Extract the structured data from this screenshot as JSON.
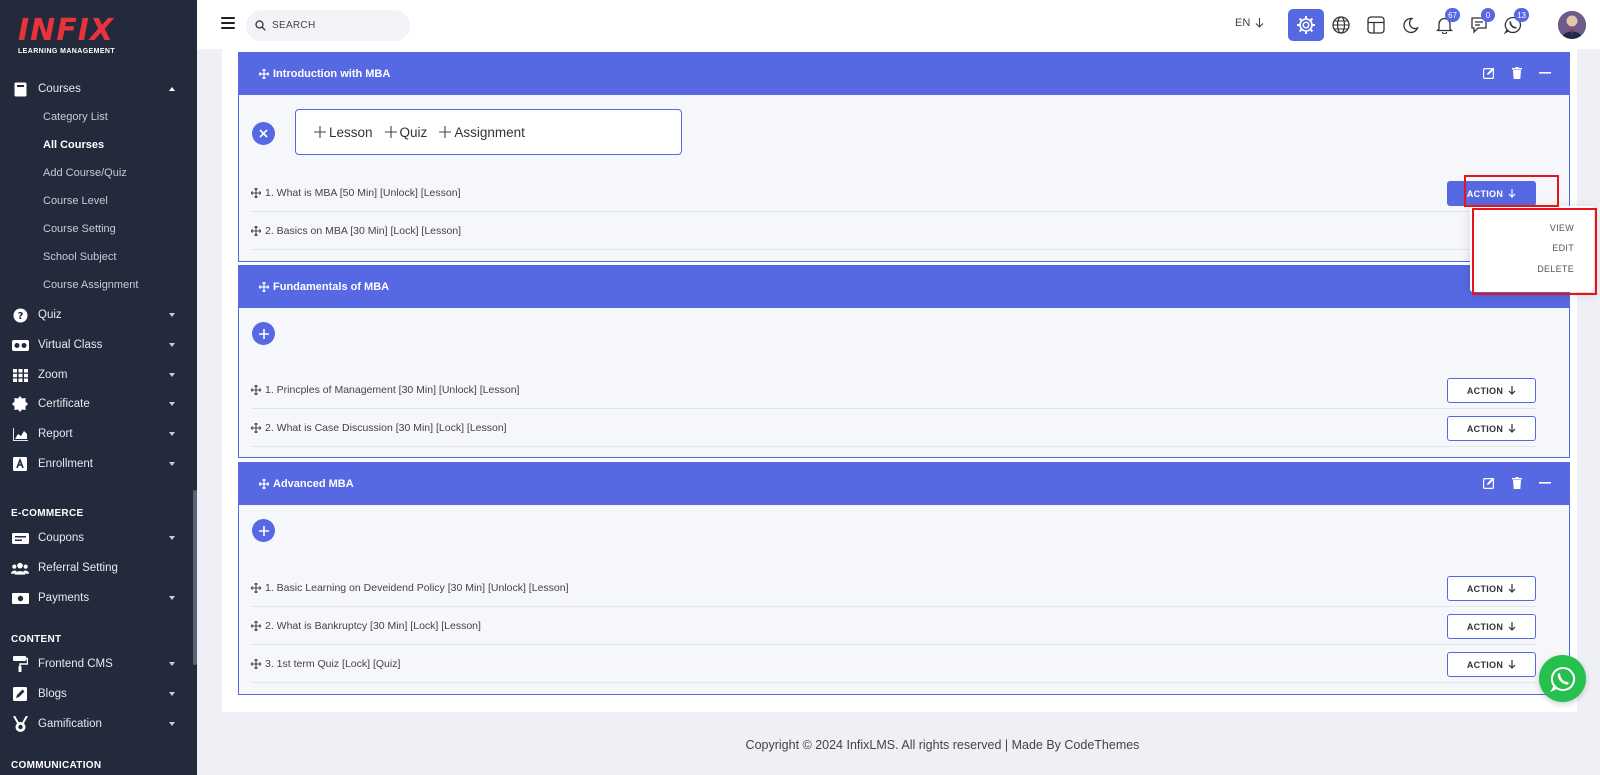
{
  "brand": {
    "logo_text": "INFIX",
    "logo_subtitle": "LEARNING MANAGEMENT"
  },
  "sidebar": {
    "courses": {
      "label": "Courses",
      "children": [
        "Category List",
        "All Courses",
        "Add Course/Quiz",
        "Course Level",
        "Course Setting",
        "School Subject",
        "Course Assignment"
      ],
      "active_child": "All Courses"
    },
    "items": [
      {
        "label": "Quiz",
        "icon": "question-icon"
      },
      {
        "label": "Virtual Class",
        "icon": "vr-icon"
      },
      {
        "label": "Zoom",
        "icon": "grid-icon"
      },
      {
        "label": "Certificate",
        "icon": "certificate-icon"
      },
      {
        "label": "Report",
        "icon": "chart-icon"
      },
      {
        "label": "Enrollment",
        "icon": "enrollment-icon"
      }
    ],
    "ecommerce_title": "E-COMMERCE",
    "ecommerce": [
      {
        "label": "Coupons",
        "icon": "coupon-icon"
      },
      {
        "label": "Referral Setting",
        "icon": "users-icon"
      },
      {
        "label": "Payments",
        "icon": "money-icon"
      }
    ],
    "content_title": "CONTENT",
    "content": [
      {
        "label": "Frontend CMS",
        "icon": "paint-roller-icon"
      },
      {
        "label": "Blogs",
        "icon": "blog-icon"
      },
      {
        "label": "Gamification",
        "icon": "medal-icon"
      }
    ],
    "communication_title": "COMMUNICATION"
  },
  "header": {
    "search_placeholder": "SEARCH",
    "language": "EN",
    "badges": {
      "notifications": "67",
      "messages": "0",
      "whatsapp": "13"
    }
  },
  "sections": [
    {
      "title": "Introduction with MBA",
      "add_options": [
        "Lesson",
        "Quiz",
        "Assignment"
      ],
      "lessons": [
        "1. What is MBA [50 Min] [Unlock] [Lesson]",
        "2. Basics on MBA [30 Min] [Lock] [Lesson]"
      ]
    },
    {
      "title": "Fundamentals of MBA",
      "lessons": [
        "1. Princples of Management [30 Min] [Unlock] [Lesson]",
        "2. What is Case Discussion [30 Min] [Lock] [Lesson]"
      ]
    },
    {
      "title": "Advanced MBA",
      "lessons": [
        "1. Basic Learning on Deveidend Policy [30 Min] [Unlock] [Lesson]",
        "2. What is Bankruptcy [30 Min] [Lock] [Lesson]",
        "3. 1st term Quiz [Lock] [Quiz]"
      ]
    }
  ],
  "action_label": "ACTION",
  "action_menu": [
    "VIEW",
    "EDIT",
    "DELETE"
  ],
  "footer": "Copyright © 2024 InfixLMS. All rights reserved | Made By CodeThemes",
  "colors": {
    "primary": "#5669e2",
    "sidebar": "#232a3b",
    "highlight": "#e8141c",
    "whatsapp": "#25c04d"
  }
}
